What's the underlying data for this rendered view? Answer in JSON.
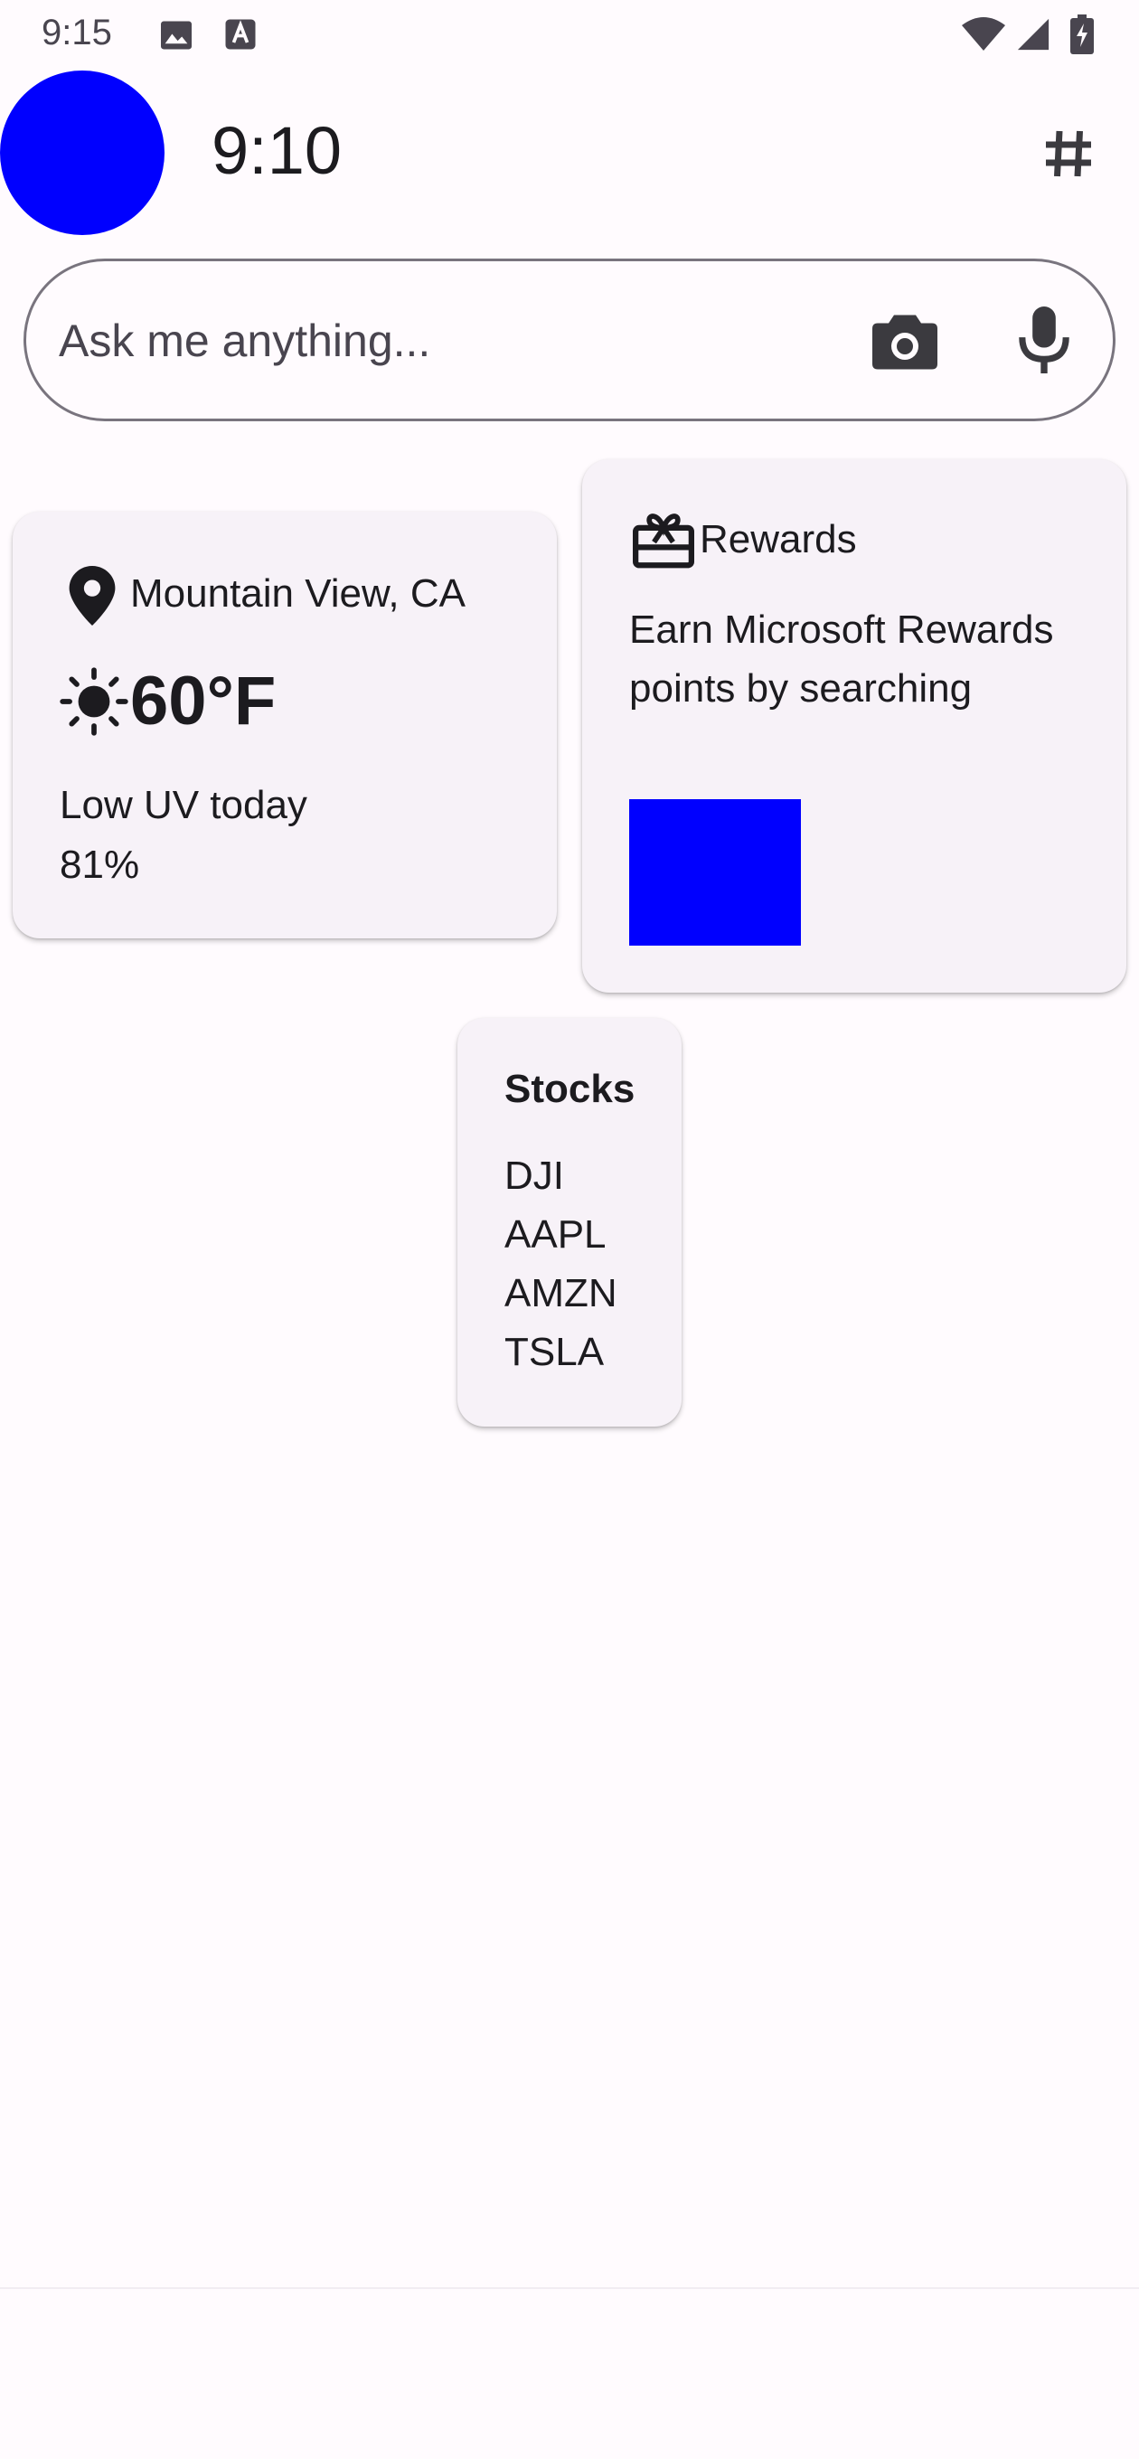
{
  "status_bar": {
    "time": "9:15",
    "icons": [
      "image-icon",
      "a-icon",
      "wifi-icon",
      "signal-icon",
      "battery-charging-icon"
    ]
  },
  "header": {
    "time": "9:10",
    "avatar_color": "#0000ff",
    "action_icon": "hash-icon"
  },
  "search": {
    "placeholder": "Ask me anything...",
    "value": "",
    "icons": [
      "camera-icon",
      "mic-icon"
    ]
  },
  "weather": {
    "location": "Mountain View, CA",
    "temperature": "60°F",
    "uv": "Low UV today",
    "humidity": "81%",
    "icons": [
      "location-pin-icon",
      "sun-icon"
    ]
  },
  "rewards": {
    "title": "Rewards",
    "text": "Earn Microsoft Rewards points by searching",
    "image_color": "#0000ff",
    "icon": "gift-card-icon"
  },
  "stocks": {
    "title": "Stocks",
    "items": [
      "DJI",
      "AAPL",
      "AMZN",
      "TSLA"
    ]
  },
  "colors": {
    "background": "#fffbfe",
    "card": "#f7f2f8",
    "outline": "#79747e",
    "text": "#1c1b1f",
    "muted_text": "#49454f",
    "accent": "#0000ff"
  }
}
